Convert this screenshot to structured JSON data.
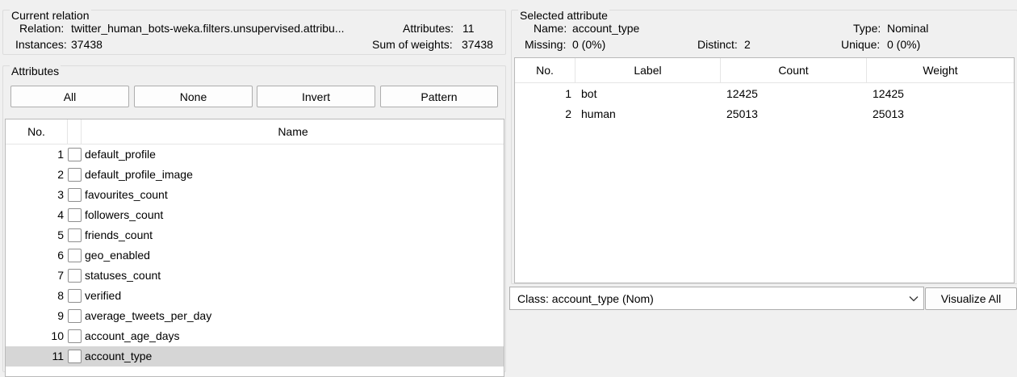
{
  "current_relation": {
    "title": "Current relation",
    "relation_label": "Relation:",
    "relation_value": "twitter_human_bots-weka.filters.unsupervised.attribu...",
    "attributes_label": "Attributes:",
    "attributes_value": "11",
    "instances_label": "Instances:",
    "instances_value": "37438",
    "sum_weights_label": "Sum of weights:",
    "sum_weights_value": "37438"
  },
  "attributes_panel": {
    "title": "Attributes",
    "buttons": {
      "all": "All",
      "none": "None",
      "invert": "Invert",
      "pattern": "Pattern"
    },
    "columns": {
      "no": "No.",
      "name": "Name"
    },
    "rows": [
      {
        "no": "1",
        "name": "default_profile"
      },
      {
        "no": "2",
        "name": "default_profile_image"
      },
      {
        "no": "3",
        "name": "favourites_count"
      },
      {
        "no": "4",
        "name": "followers_count"
      },
      {
        "no": "5",
        "name": "friends_count"
      },
      {
        "no": "6",
        "name": "geo_enabled"
      },
      {
        "no": "7",
        "name": "statuses_count"
      },
      {
        "no": "8",
        "name": "verified"
      },
      {
        "no": "9",
        "name": "average_tweets_per_day"
      },
      {
        "no": "10",
        "name": "account_age_days"
      },
      {
        "no": "11",
        "name": "account_type"
      }
    ]
  },
  "selected_attribute": {
    "title": "Selected attribute",
    "name_label": "Name:",
    "name_value": "account_type",
    "type_label": "Type:",
    "type_value": "Nominal",
    "missing_label": "Missing:",
    "missing_value": "0 (0%)",
    "distinct_label": "Distinct:",
    "distinct_value": "2",
    "unique_label": "Unique:",
    "unique_value": "0 (0%)",
    "columns": {
      "no": "No.",
      "label": "Label",
      "count": "Count",
      "weight": "Weight"
    },
    "rows": [
      {
        "no": "1",
        "label": "bot",
        "count": "12425",
        "weight": "12425"
      },
      {
        "no": "2",
        "label": "human",
        "count": "25013",
        "weight": "25013"
      }
    ]
  },
  "class_selector": {
    "value": "Class: account_type (Nom)"
  },
  "visualize_all": "Visualize All"
}
